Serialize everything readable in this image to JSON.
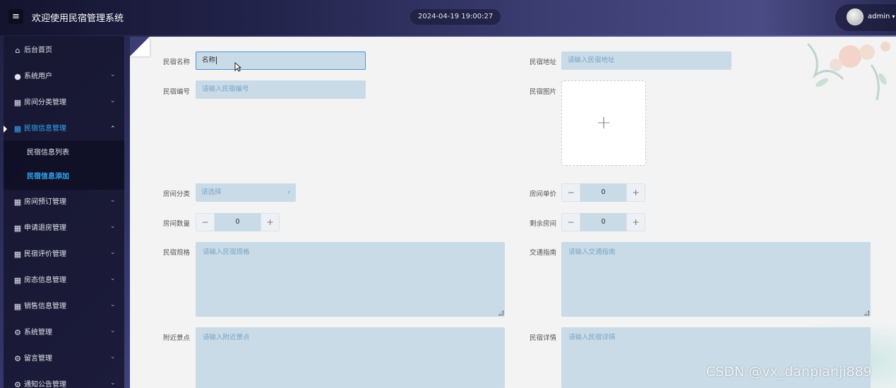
{
  "header": {
    "menu_icon": "≡",
    "title": "欢迎使用民宿管理系统",
    "datetime": "2024-04-19 19:00:27",
    "username": "admin",
    "username_caret": "▾"
  },
  "sidebar": {
    "items": [
      {
        "label": "后台首页",
        "icon": "home-icon",
        "glyph": "⌂",
        "has_children": false
      },
      {
        "label": "系统用户",
        "icon": "user-icon",
        "glyph": "●",
        "has_children": true
      },
      {
        "label": "房间分类管理",
        "icon": "grid-icon",
        "glyph": "▦",
        "has_children": true
      },
      {
        "label": "民宿信息管理",
        "icon": "grid-icon",
        "glyph": "▦",
        "has_children": true,
        "expanded": true,
        "active": true
      },
      {
        "label": "房间预订管理",
        "icon": "grid-icon",
        "glyph": "▦",
        "has_children": true
      },
      {
        "label": "申请退房管理",
        "icon": "grid-icon",
        "glyph": "▦",
        "has_children": true
      },
      {
        "label": "民宿评价管理",
        "icon": "grid-icon",
        "glyph": "▦",
        "has_children": true
      },
      {
        "label": "房态信息管理",
        "icon": "grid-icon",
        "glyph": "▦",
        "has_children": true
      },
      {
        "label": "销售信息管理",
        "icon": "grid-icon",
        "glyph": "▦",
        "has_children": true
      },
      {
        "label": "系统管理",
        "icon": "gear-icon",
        "glyph": "⚙",
        "has_children": true
      },
      {
        "label": "留言管理",
        "icon": "gear-icon",
        "glyph": "⚙",
        "has_children": true
      },
      {
        "label": "通知公告管理",
        "icon": "gear-icon",
        "glyph": "⚙",
        "has_children": true
      }
    ],
    "sub_items": [
      {
        "label": "民宿信息列表",
        "active": false
      },
      {
        "label": "民宿信息添加",
        "active": true
      }
    ],
    "chevron_down": "⌄",
    "chevron_up": "⌃"
  },
  "form": {
    "name": {
      "label": "民宿名称",
      "value": "名称"
    },
    "address": {
      "label": "民宿地址",
      "placeholder": "请输入民宿地址"
    },
    "code": {
      "label": "民宿编号",
      "placeholder": "请输入民宿编号"
    },
    "image": {
      "label": "民宿图片",
      "upload_glyph": "+"
    },
    "room_category": {
      "label": "房间分类",
      "placeholder": "请选择"
    },
    "room_price": {
      "label": "房间单价",
      "value": "0"
    },
    "room_count": {
      "label": "房间数量",
      "value": "0"
    },
    "rooms_left": {
      "label": "剩余房间",
      "value": "0"
    },
    "spec": {
      "label": "民宿规格",
      "placeholder": "请输入民宿规格"
    },
    "traffic": {
      "label": "交通指南",
      "placeholder": "请输入交通指南"
    },
    "nearby": {
      "label": "附近景点",
      "placeholder": "请输入附近景点"
    },
    "detail": {
      "label": "民宿详情",
      "placeholder": "请输入民宿详情"
    },
    "stepper_minus": "−",
    "stepper_plus": "+"
  },
  "watermark": "CSDN @vx_danpianji889",
  "colors": {
    "accent": "#35a8f5",
    "input_bg": "#c9dbe7",
    "content_bg": "#f3f3f4"
  }
}
